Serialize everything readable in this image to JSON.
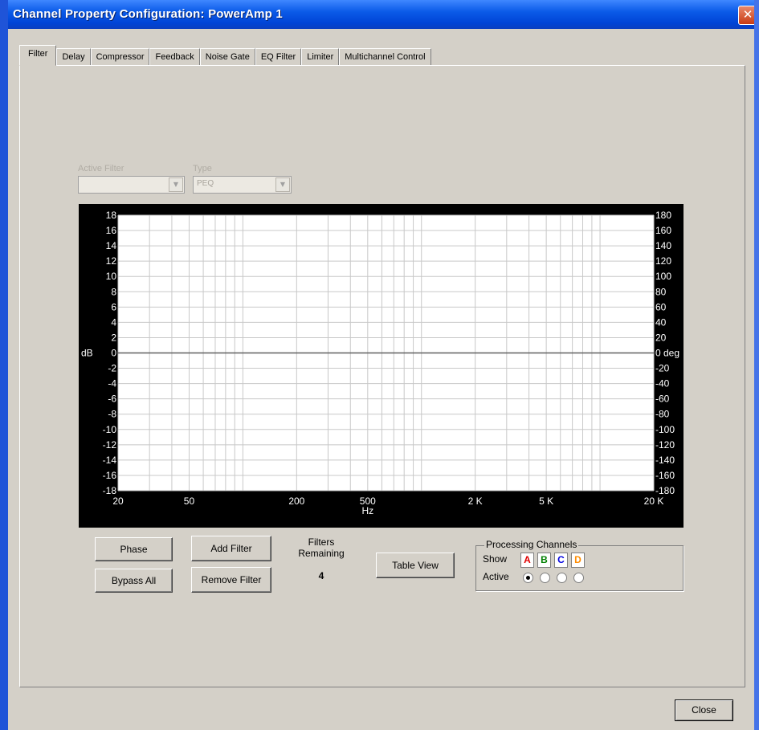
{
  "window": {
    "title": "Channel Property Configuration: PowerAmp 1",
    "close_glyph": "✕"
  },
  "tabs": [
    "Filter",
    "Delay",
    "Compressor",
    "Feedback",
    "Noise Gate",
    "EQ Filter",
    "Limiter",
    "Multichannel Control"
  ],
  "active_tab": "Filter",
  "filter": {
    "active_filter_label": "Active Filter",
    "active_filter_value": "",
    "type_label": "Type",
    "type_value": "PEQ",
    "dropdown_glyph": "▼"
  },
  "chart_data": {
    "type": "line",
    "title": "",
    "xlabel": "Hz",
    "ylabel_left": "dB",
    "ylabel_right": "deg",
    "x_scale": "log",
    "xlim": [
      20,
      20000
    ],
    "ylim_left": [
      -18,
      18
    ],
    "ylim_right": [
      -180,
      180
    ],
    "x_tick_values": [
      20,
      50,
      200,
      500,
      2000,
      5000,
      20000
    ],
    "x_tick_labels": [
      "20",
      "50",
      "200",
      "500",
      "2 K",
      "5 K",
      "20 K"
    ],
    "y_left_ticks": [
      "18",
      "16",
      "14",
      "12",
      "10",
      "8",
      "6",
      "4",
      "2",
      "0",
      "-2",
      "-4",
      "-6",
      "-8",
      "-10",
      "-12",
      "-14",
      "-16",
      "-18"
    ],
    "y_right_ticks": [
      "180",
      "160",
      "140",
      "120",
      "100",
      "80",
      "60",
      "40",
      "20",
      "0 deg",
      "-20",
      "-40",
      "-60",
      "-80",
      "-100",
      "-120",
      "-140",
      "-160",
      "-180"
    ],
    "grid": true,
    "series": [
      {
        "x": [
          20,
          20000
        ],
        "y": [
          0,
          0
        ],
        "color": "#606060"
      }
    ]
  },
  "buttons": {
    "phase": "Phase",
    "bypass_all": "Bypass All",
    "add_filter": "Add Filter",
    "remove_filter": "Remove Filter",
    "table_view": "Table View",
    "close": "Close"
  },
  "filters_remaining": {
    "label_line1": "Filters",
    "label_line2": "Remaining",
    "value": "4"
  },
  "processing_channels": {
    "title": "Processing Channels",
    "show_label": "Show",
    "active_label": "Active",
    "channels": [
      {
        "label": "A",
        "color": "#e00000",
        "active": true
      },
      {
        "label": "B",
        "color": "#008000",
        "active": false
      },
      {
        "label": "C",
        "color": "#0000e0",
        "active": false
      },
      {
        "label": "D",
        "color": "#ff8c00",
        "active": false
      }
    ]
  }
}
